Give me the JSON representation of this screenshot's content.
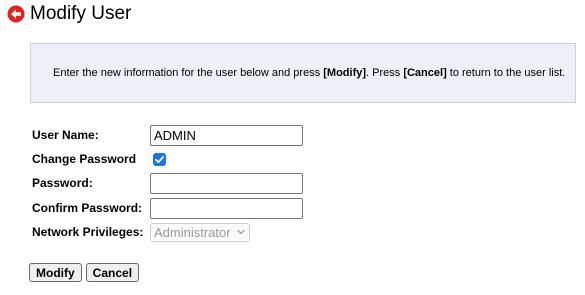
{
  "page": {
    "title": "Modify User"
  },
  "info": {
    "text_1": "Enter the new information for the user below and press ",
    "modify_bold": "[Modify]",
    "text_2": ". Press ",
    "cancel_bold": "[Cancel]",
    "text_3": " to return to the user list."
  },
  "form": {
    "user_name_label": "User Name:",
    "user_name_value": "ADMIN",
    "change_password_label": "Change Password",
    "change_password_checked": true,
    "password_label": "Password:",
    "password_value": "",
    "confirm_password_label": "Confirm Password:",
    "confirm_password_value": "",
    "network_privileges_label": "Network Privileges:",
    "network_privileges_value": "Administrator"
  },
  "buttons": {
    "modify_label": "Modify",
    "cancel_label": "Cancel"
  },
  "icons": {
    "back": "back-arrow-icon",
    "checkbox": "checkmark-icon",
    "select": "chevron-down-icon"
  },
  "colors": {
    "accent_red": "#e3211c",
    "checkbox_blue": "#1a73e8",
    "info_bg": "#eef0f8"
  }
}
